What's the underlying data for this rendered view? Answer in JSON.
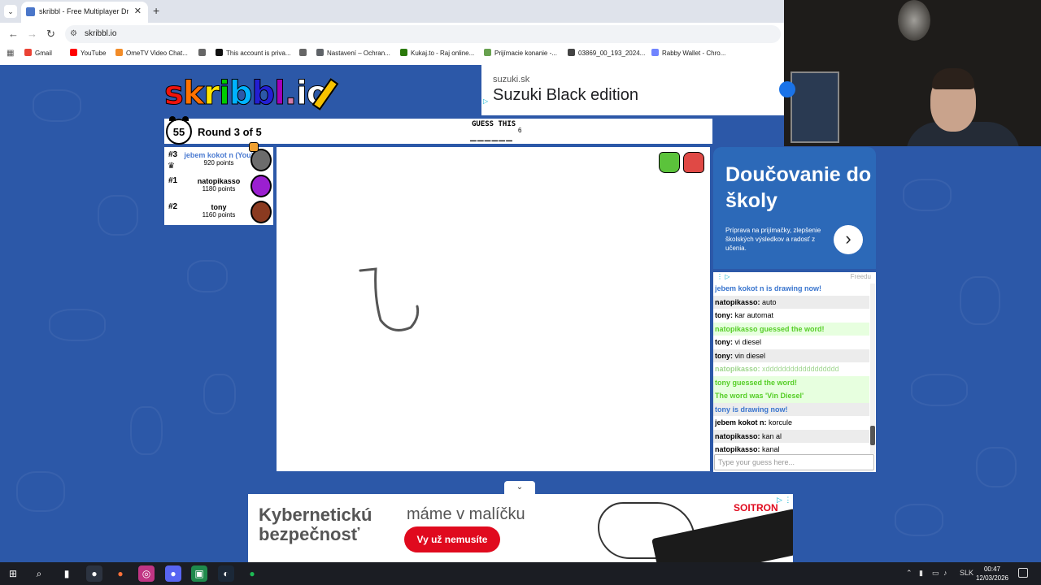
{
  "browser": {
    "tab_title": "skribbl - Free Multiplayer Draw",
    "url": "skribbl.io",
    "bookmarks": [
      {
        "label": "Gmail",
        "color": "#ea4335"
      },
      {
        "label": "YouTube",
        "color": "#ff0000"
      },
      {
        "label": "OmeTV Video Chat...",
        "color": "#f28c28"
      },
      {
        "label": "",
        "color": "#666666"
      },
      {
        "label": "This account is priva...",
        "color": "#111111"
      },
      {
        "label": "",
        "color": "#666666"
      },
      {
        "label": "Nastavení – Ochran...",
        "color": "#5f6368"
      },
      {
        "label": "Kukaj.to - Raj online...",
        "color": "#2b7a0b"
      },
      {
        "label": "Prijímacie konanie -...",
        "color": "#68a14f"
      },
      {
        "label": "03869_00_193_2024...",
        "color": "#444444"
      },
      {
        "label": "Rabby Wallet - Chro...",
        "color": "#7084ff"
      }
    ]
  },
  "ads": {
    "top": {
      "domain": "suzuki.sk",
      "headline": "Suzuki Black edition"
    },
    "side": {
      "title": "Doučovanie do školy",
      "body": "Príprava na prijímačky, zlepšenie školských výsledkov a radosť z učenia.",
      "arrow": "›",
      "sponsor": "Freedu"
    },
    "bottom": {
      "title": "Kybernetickú bezpečnosť",
      "subtitle": "máme v malíčku",
      "button": "Vy už nemusíte",
      "brand": "SOITRON"
    }
  },
  "game": {
    "timer": "55",
    "round": "Round 3 of 5",
    "guess_label": "GUESS THIS",
    "word_blanks": "______",
    "word_length": "6",
    "players": [
      {
        "rank": "#3",
        "name": "jebem kokot n (You)",
        "points": "920 points",
        "you": true,
        "avatar_color": "#6c6c6c"
      },
      {
        "rank": "#1",
        "name": "natopikasso",
        "points": "1180 points",
        "you": false,
        "avatar_color": "#9b1fd0"
      },
      {
        "rank": "#2",
        "name": "tony",
        "points": "1160 points",
        "you": false,
        "avatar_color": "#8a3a20"
      }
    ]
  },
  "chat": {
    "messages": [
      {
        "kind": "sys-blue",
        "user": "",
        "text": "jebem kokot n is drawing now!"
      },
      {
        "kind": "normal",
        "user": "natopikasso:",
        "text": "auto"
      },
      {
        "kind": "normal",
        "user": "tony:",
        "text": "kar automat"
      },
      {
        "kind": "sys-green",
        "user": "",
        "text": "natopikasso guessed the word!"
      },
      {
        "kind": "normal",
        "user": "tony:",
        "text": "vi diesel"
      },
      {
        "kind": "normal",
        "user": "tony:",
        "text": "vin diesel"
      },
      {
        "kind": "faded",
        "user": "natopikasso:",
        "text": "xdddddddddddddddddd"
      },
      {
        "kind": "sys-green",
        "user": "",
        "text": "tony guessed the word!"
      },
      {
        "kind": "sys-green",
        "user": "",
        "text": "The word was 'Vin Diesel'"
      },
      {
        "kind": "sys-blue",
        "user": "",
        "text": "tony is drawing now!"
      },
      {
        "kind": "normal",
        "user": "jebem kokot n:",
        "text": "korcule"
      },
      {
        "kind": "normal",
        "user": "natopikasso:",
        "text": "kan al"
      },
      {
        "kind": "normal",
        "user": "natopikasso:",
        "text": "kanal"
      }
    ],
    "input_placeholder": "Type your guess here..."
  },
  "taskbar": {
    "language": "SLK",
    "time": "00:47",
    "date": "12/03/2026"
  }
}
